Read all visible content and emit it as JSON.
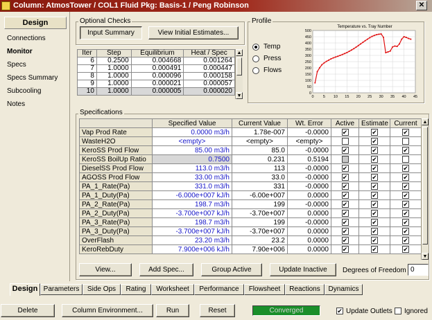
{
  "window": {
    "title": "Column: AtmosTower / COL1  Fluid Pkg: Basis-1 / Peng Robinson",
    "close_glyph": "✕"
  },
  "sidebar": {
    "title": "Design",
    "items": [
      {
        "label": "Connections",
        "active": false
      },
      {
        "label": "Monitor",
        "active": true
      },
      {
        "label": "Specs",
        "active": false
      },
      {
        "label": "Specs Summary",
        "active": false
      },
      {
        "label": "Subcooling",
        "active": false
      },
      {
        "label": "Notes",
        "active": false
      }
    ]
  },
  "optional_checks": {
    "label": "Optional Checks",
    "input_summary": "Input Summary",
    "view_initial_estimates": "View Initial Estimates..."
  },
  "iterations": {
    "columns": [
      "Iter",
      "Step",
      "Equilibrium",
      "Heat / Spec"
    ],
    "rows": [
      [
        "6",
        "0.2500",
        "0.004668",
        "0.001264"
      ],
      [
        "7",
        "1.0000",
        "0.000491",
        "0.000447"
      ],
      [
        "8",
        "1.0000",
        "0.000096",
        "0.000158"
      ],
      [
        "9",
        "1.0000",
        "0.000021",
        "0.000057"
      ],
      [
        "10",
        "1.0000",
        "0.000005",
        "0.000020"
      ]
    ]
  },
  "profile": {
    "label": "Profile",
    "options": [
      {
        "label": "Temp",
        "selected": true
      },
      {
        "label": "Press",
        "selected": false
      },
      {
        "label": "Flows",
        "selected": false
      }
    ]
  },
  "chart_data": {
    "type": "line",
    "title": "Temperature vs. Tray Number",
    "xlabel": "",
    "ylabel": "",
    "xlim": [
      0,
      45
    ],
    "ylim": [
      0,
      500
    ],
    "xticks": [
      0,
      5,
      10,
      15,
      20,
      25,
      30,
      35,
      40,
      45
    ],
    "yticks": [
      0,
      50,
      100,
      150,
      200,
      250,
      300,
      350,
      400,
      450,
      500
    ],
    "grid": true,
    "color": "#e01010",
    "series": [
      {
        "x": [
          1,
          2,
          3,
          4,
          5,
          6,
          7,
          8,
          9,
          10,
          11,
          12,
          13,
          14,
          15,
          16,
          17,
          18,
          19,
          20,
          21,
          22,
          23,
          24,
          25,
          26,
          27,
          28,
          29,
          30,
          31,
          32,
          33,
          34,
          35,
          36,
          37,
          38,
          39,
          40,
          41,
          42,
          43
        ],
        "values": [
          80,
          170,
          200,
          225,
          240,
          252,
          262,
          272,
          280,
          287,
          293,
          300,
          307,
          315,
          323,
          333,
          343,
          354,
          366,
          379,
          392,
          405,
          418,
          430,
          442,
          452,
          460,
          466,
          470,
          472,
          445,
          322,
          328,
          335,
          368,
          375,
          372,
          392,
          430,
          450,
          444,
          436,
          430
        ]
      }
    ]
  },
  "specifications": {
    "label": "Specifications",
    "columns": [
      "",
      "Specified Value",
      "Current Value",
      "Wt. Error",
      "Active",
      "Estimate",
      "Current"
    ],
    "rows": [
      {
        "name": "Vap Prod Rate",
        "specified": "0.0000 m3/h",
        "current": "1.78e-007",
        "error": "-0.0000",
        "active": true,
        "estimate": true,
        "current_flag": true
      },
      {
        "name": "WasteH2O",
        "specified": "<empty>",
        "current": "<empty>",
        "error": "<empty>",
        "active": false,
        "estimate": true,
        "current_flag": false
      },
      {
        "name": "KeroSS Prod Flow",
        "specified": "85.00 m3/h",
        "current": "85.0",
        "error": "-0.0000",
        "active": true,
        "estimate": true,
        "current_flag": true
      },
      {
        "name": "KeroSS BoilUp Ratio",
        "specified": "0.7500",
        "current": "0.231",
        "error": "0.5194",
        "active": false,
        "estimate": true,
        "current_flag": false
      },
      {
        "name": "DieselSS Prod Flow",
        "specified": "113.0 m3/h",
        "current": "113",
        "error": "-0.0000",
        "active": true,
        "estimate": true,
        "current_flag": true
      },
      {
        "name": "AGOSS Prod Flow",
        "specified": "33.00 m3/h",
        "current": "33.0",
        "error": "-0.0000",
        "active": true,
        "estimate": true,
        "current_flag": true
      },
      {
        "name": "PA_1_Rate(Pa)",
        "specified": "331.0 m3/h",
        "current": "331",
        "error": "-0.0000",
        "active": true,
        "estimate": true,
        "current_flag": true
      },
      {
        "name": "PA_1_Duty(Pa)",
        "specified": "-6.000e+007 kJ/h",
        "current": "-6.00e+007",
        "error": "0.0000",
        "active": true,
        "estimate": true,
        "current_flag": true
      },
      {
        "name": "PA_2_Rate(Pa)",
        "specified": "198.7 m3/h",
        "current": "199",
        "error": "-0.0000",
        "active": true,
        "estimate": true,
        "current_flag": true
      },
      {
        "name": "PA_2_Duty(Pa)",
        "specified": "-3.700e+007 kJ/h",
        "current": "-3.70e+007",
        "error": "0.0000",
        "active": true,
        "estimate": true,
        "current_flag": true
      },
      {
        "name": "PA_3_Rate(Pa)",
        "specified": "198.7 m3/h",
        "current": "199",
        "error": "-0.0000",
        "active": true,
        "estimate": true,
        "current_flag": true
      },
      {
        "name": "PA_3_Duty(Pa)",
        "specified": "-3.700e+007 kJ/h",
        "current": "-3.70e+007",
        "error": "0.0000",
        "active": true,
        "estimate": true,
        "current_flag": true
      },
      {
        "name": "OverFlash",
        "specified": "23.20 m3/h",
        "current": "23.2",
        "error": "0.0000",
        "active": true,
        "estimate": true,
        "current_flag": true
      },
      {
        "name": "KeroRebDuty",
        "specified": "7.900e+006 kJ/h",
        "current": "7.90e+006",
        "error": "0.0000",
        "active": true,
        "estimate": true,
        "current_flag": true
      }
    ]
  },
  "actions": {
    "view": "View...",
    "add_spec": "Add Spec...",
    "group_active": "Group Active",
    "update_inactive": "Update Inactive",
    "dof_label": "Degrees of Freedom",
    "dof_value": "0"
  },
  "tabs": [
    "Design",
    "Parameters",
    "Side Ops",
    "Rating",
    "Worksheet",
    "Performance",
    "Flowsheet",
    "Reactions",
    "Dynamics"
  ],
  "footer": {
    "delete": "Delete",
    "column_environment": "Column Environment...",
    "run": "Run",
    "reset": "Reset",
    "status": "Converged",
    "status_color": "#1a8f2a",
    "update_outlets": "Update Outlets",
    "update_outlets_checked": true,
    "ignored": "Ignored",
    "ignored_checked": false
  }
}
